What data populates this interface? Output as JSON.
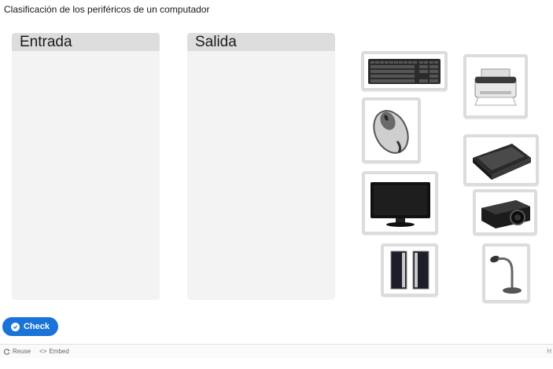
{
  "task": {
    "title": "Clasificación de los periféricos de un computador"
  },
  "dropzones": [
    {
      "label": "Entrada"
    },
    {
      "label": "Salida"
    }
  ],
  "draggables": [
    {
      "icon": "keyboard-icon"
    },
    {
      "icon": "printer-icon"
    },
    {
      "icon": "mouse-icon"
    },
    {
      "icon": "scanner-icon"
    },
    {
      "icon": "monitor-icon"
    },
    {
      "icon": "projector-icon"
    },
    {
      "icon": "speakers-icon"
    },
    {
      "icon": "microphone-icon"
    }
  ],
  "actions": {
    "check_label": "Check"
  },
  "footer": {
    "reuse_label": "Reuse",
    "embed_label": "Embed",
    "h5p_label": "H"
  },
  "colors": {
    "accent": "#1a73d9",
    "dropzone_bg": "#f3f3f3",
    "dropzone_header": "#dddddd",
    "item_frame": "#dcdcdc"
  }
}
